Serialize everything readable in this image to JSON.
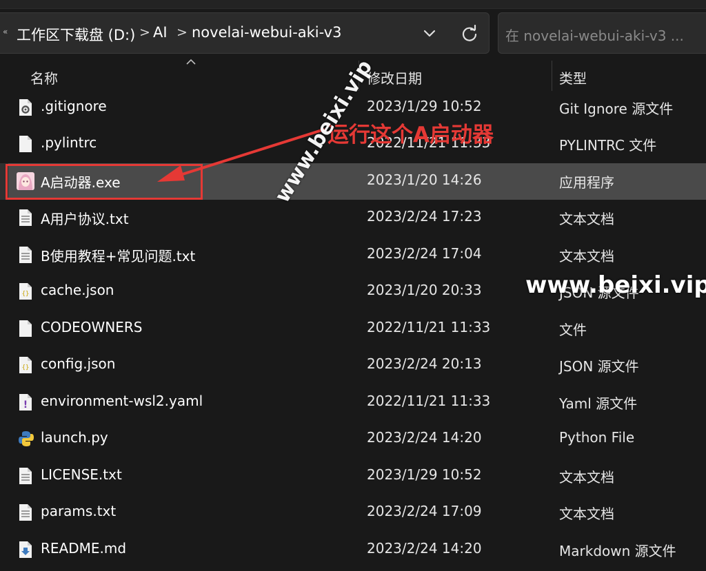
{
  "breadcrumb": {
    "items": [
      "工作区下载盘 (D:)",
      "AI",
      "novelai-webui-aki-v3"
    ],
    "separator": ">"
  },
  "toolbar": {
    "left_arrow": "«",
    "dropdown_icon": "chevron-down-icon",
    "refresh_icon": "refresh-icon"
  },
  "search": {
    "placeholder": "在 novelai-webui-aki-v3 ..."
  },
  "columns": {
    "name": "名称",
    "date": "修改日期",
    "type": "类型"
  },
  "files": [
    {
      "name": ".gitignore",
      "date": "2023/1/29 10:52",
      "type": "Git Ignore 源文件",
      "icon": "gear-file-icon"
    },
    {
      "name": ".pylintrc",
      "date": "2022/11/21 11:33",
      "type": "PYLINTRC 文件",
      "icon": "blank-file-icon"
    },
    {
      "name": "A启动器.exe",
      "date": "2023/1/20 14:26",
      "type": "应用程序",
      "icon": "anime-app-icon",
      "selected": true
    },
    {
      "name": "A用户协议.txt",
      "date": "2023/2/24 17:23",
      "type": "文本文档",
      "icon": "text-file-icon"
    },
    {
      "name": "B使用教程+常见问题.txt",
      "date": "2023/2/24 17:04",
      "type": "文本文档",
      "icon": "text-file-icon"
    },
    {
      "name": "cache.json",
      "date": "2023/1/20 20:33",
      "type": "JSON 源文件",
      "icon": "json-file-icon"
    },
    {
      "name": "CODEOWNERS",
      "date": "2022/11/21 11:33",
      "type": "文件",
      "icon": "blank-file-icon"
    },
    {
      "name": "config.json",
      "date": "2023/2/24 20:13",
      "type": "JSON 源文件",
      "icon": "json-file-icon"
    },
    {
      "name": "environment-wsl2.yaml",
      "date": "2022/11/21 11:33",
      "type": "Yaml 源文件",
      "icon": "yaml-file-icon"
    },
    {
      "name": "launch.py",
      "date": "2023/2/24 14:20",
      "type": "Python File",
      "icon": "python-file-icon"
    },
    {
      "name": "LICENSE.txt",
      "date": "2023/1/29 10:52",
      "type": "文本文档",
      "icon": "text-file-icon"
    },
    {
      "name": "params.txt",
      "date": "2023/2/24 17:09",
      "type": "文本文档",
      "icon": "text-file-icon"
    },
    {
      "name": "README.md",
      "date": "2023/2/24 14:20",
      "type": "Markdown 源文件",
      "icon": "markdown-file-icon"
    }
  ],
  "annotation": {
    "text": "运行这个A启动器",
    "color": "#e53935"
  },
  "watermarks": [
    "www.beixi.vip",
    "www.beixi.vip"
  ],
  "colors": {
    "background": "#191919",
    "selected_row": "#4a4a4a",
    "accent_red": "#e53935"
  }
}
